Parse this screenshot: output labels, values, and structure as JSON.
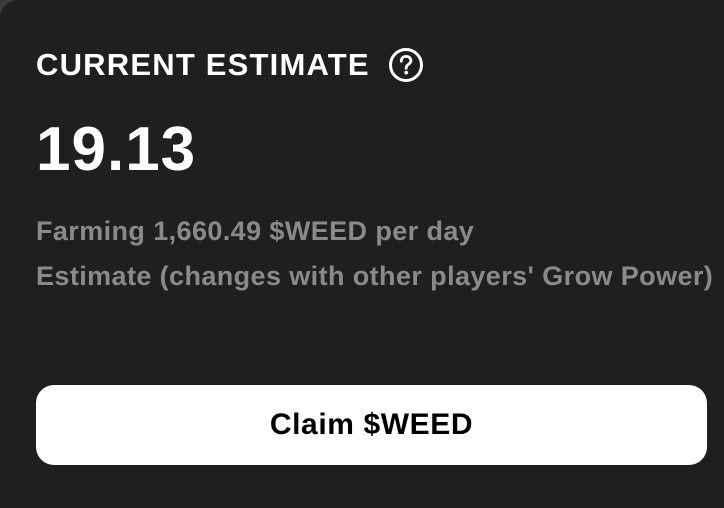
{
  "estimate": {
    "title": "CURRENT ESTIMATE",
    "help_icon": "question-circle-icon",
    "value": "19.13",
    "farming_text": "Farming 1,660.49 $WEED per day",
    "note_text": "Estimate (changes with other players' Grow Power)"
  },
  "actions": {
    "claim_label": "Claim $WEED"
  },
  "colors": {
    "card_background": "#1f1f1f",
    "primary_text": "#ffffff",
    "secondary_text": "#8a8a8a",
    "button_background": "#ffffff",
    "button_text": "#000000"
  }
}
